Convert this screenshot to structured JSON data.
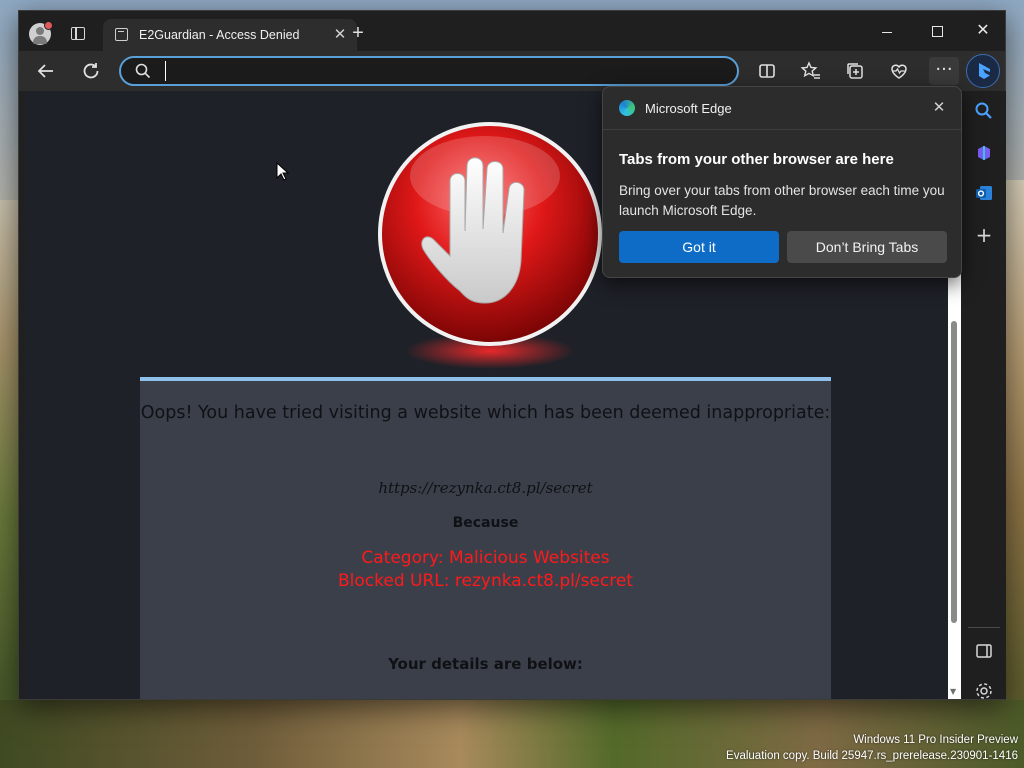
{
  "tab": {
    "title": "E2Guardian - Access Denied"
  },
  "address_bar": {
    "value": "",
    "placeholder": ""
  },
  "page": {
    "message": "Oops! You have tried visiting a website which has been deemed inappropriate:",
    "blocked_url": "https://rezynka.ct8.pl/secret",
    "because_label": "Because",
    "category": "Category: Malicious Websites",
    "blocked_url_reason": "Blocked URL: rezynka.ct8.pl/secret",
    "details_heading": "Your details are below:"
  },
  "popup": {
    "app_name": "Microsoft Edge",
    "title": "Tabs from your other browser are here",
    "body": "Bring over your tabs from other browser each time you launch Microsoft Edge.",
    "primary_button": "Got it",
    "secondary_button": "Don’t Bring Tabs"
  },
  "watermark": {
    "line1": "Windows 11 Pro Insider Preview",
    "line2": "Evaluation copy. Build 25947.rs_prerelease.230901-1416"
  },
  "icons": {
    "back": "arrow-left-icon",
    "refresh": "refresh-icon",
    "split_screen": "split-screen-icon",
    "favorites": "favorites-icon",
    "collections": "collections-icon",
    "browser_essentials": "heart-pulse-icon",
    "more": "ellipsis-icon"
  },
  "colors": {
    "accent": "#0f6cc6",
    "reason_text": "#ff1a1a",
    "box_top_border": "#8ec0ea"
  }
}
